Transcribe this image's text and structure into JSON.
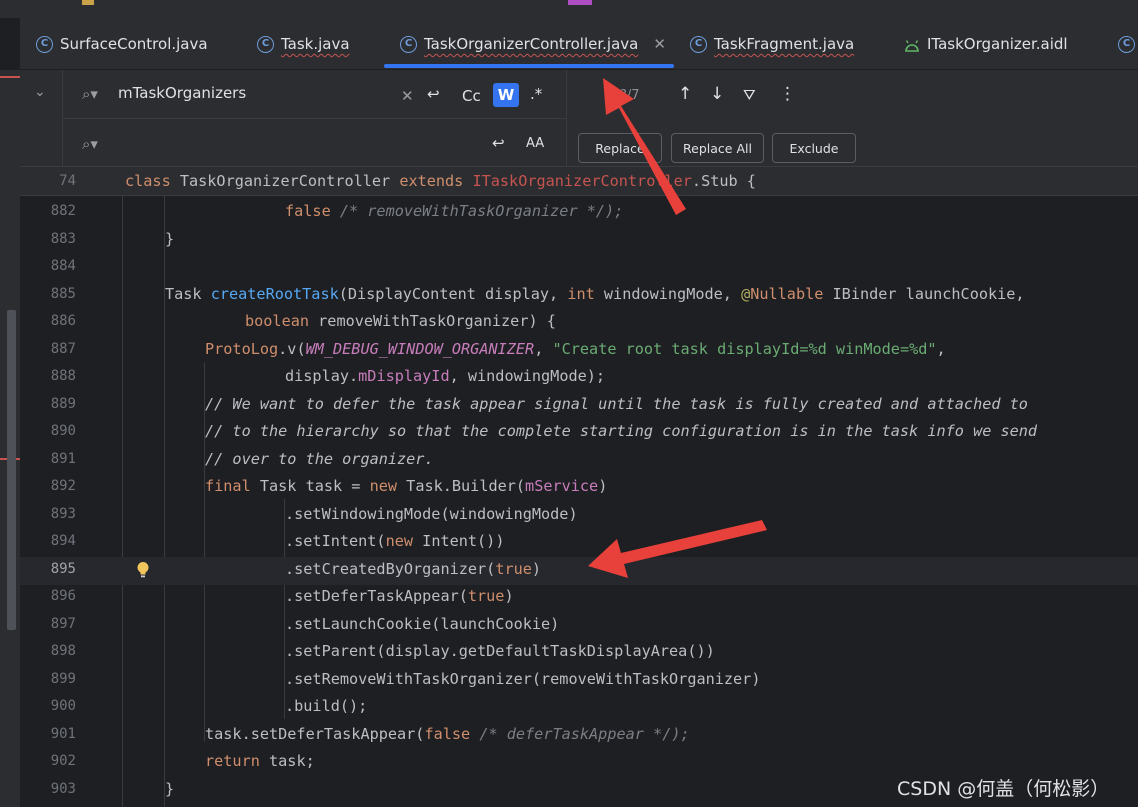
{
  "tabs": [
    {
      "label": "SurfaceControl.java",
      "icon": "class-icon",
      "error": false
    },
    {
      "label": "Task.java",
      "icon": "class-icon",
      "error": true
    },
    {
      "label": "TaskOrganizerController.java",
      "icon": "class-icon",
      "error": true,
      "active": true
    },
    {
      "label": "TaskFragment.java",
      "icon": "class-icon",
      "error": true
    },
    {
      "label": "ITaskOrganizer.aidl",
      "icon": "android-icon",
      "error": false
    },
    {
      "label": "",
      "icon": "class-icon"
    }
  ],
  "find": {
    "query": "mTaskOrganizers",
    "result_count": "?/7",
    "match_case_label": "Cc",
    "words_label": "W",
    "regex_label": ".*",
    "preserve_case_label": "AA",
    "buttons": {
      "replace": "Replace",
      "replace_all": "Replace All",
      "exclude": "Exclude"
    }
  },
  "sticky": {
    "num": "74"
  },
  "lines": [
    {
      "num": "882"
    },
    {
      "num": "883"
    },
    {
      "num": "884"
    },
    {
      "num": "885"
    },
    {
      "num": "886"
    },
    {
      "num": "887"
    },
    {
      "num": "888"
    },
    {
      "num": "889"
    },
    {
      "num": "890"
    },
    {
      "num": "891"
    },
    {
      "num": "892"
    },
    {
      "num": "893"
    },
    {
      "num": "894"
    },
    {
      "num": "895"
    },
    {
      "num": "896"
    },
    {
      "num": "897"
    },
    {
      "num": "898"
    },
    {
      "num": "899"
    },
    {
      "num": "900"
    },
    {
      "num": "901"
    },
    {
      "num": "902"
    },
    {
      "num": "903"
    }
  ],
  "code": {
    "sticky": [
      "class",
      " TaskOrganizerController ",
      "extends",
      " ITaskOrganizerController",
      ".Stub {"
    ],
    "l882": [
      "false",
      " /* removeWithTaskOrganizer */);"
    ],
    "l883": "}",
    "l885": [
      "Task ",
      "createRootTask",
      "(DisplayContent display, ",
      "int",
      " windowingMode, ",
      "@",
      "Nullable",
      " IBinder launchCookie,"
    ],
    "l886": [
      "boolean",
      " removeWithTaskOrganizer) {"
    ],
    "l887": [
      "ProtoLog",
      ".v(",
      "WM_DEBUG_WINDOW_ORGANIZER",
      ", ",
      "\"Create root task displayId=%d winMode=%d\"",
      ","
    ],
    "l888": [
      "display.",
      "mDisplayId",
      ", windowingMode);"
    ],
    "l889": "// We want to defer the task appear signal until the task is fully created and attached to",
    "l890": "// to the hierarchy so that the complete starting configuration is in the task info we send",
    "l891": "// over to the organizer.",
    "l892": [
      "final",
      " Task task = ",
      "new",
      " Task.Builder(",
      "mService",
      ")"
    ],
    "l893": ".setWindowingMode(windowingMode)",
    "l894": [
      ".setIntent(",
      "new",
      " Intent())"
    ],
    "l895": [
      ".setCreatedByOrganizer(",
      "true",
      ")"
    ],
    "l896": [
      ".setDeferTaskAppear(",
      "true",
      ")"
    ],
    "l897": ".setLaunchCookie(launchCookie)",
    "l898": ".setParent(display.getDefaultTaskDisplayArea())",
    "l899": ".setRemoveWithTaskOrganizer(removeWithTaskOrganizer)",
    "l900": ".build();",
    "l901": [
      "task.setDeferTaskAppear(",
      "false",
      " /* deferTaskAppear */);"
    ],
    "l902": [
      "return",
      " task;"
    ],
    "l903": "}"
  },
  "watermark": "CSDN @何盖（何松影）",
  "colors": {
    "accent": "#3574f0",
    "arrow": "#e8403a",
    "keyword": "#cf8e6d",
    "function": "#56a8f5",
    "string": "#6aab73",
    "field": "#c77dbb"
  }
}
